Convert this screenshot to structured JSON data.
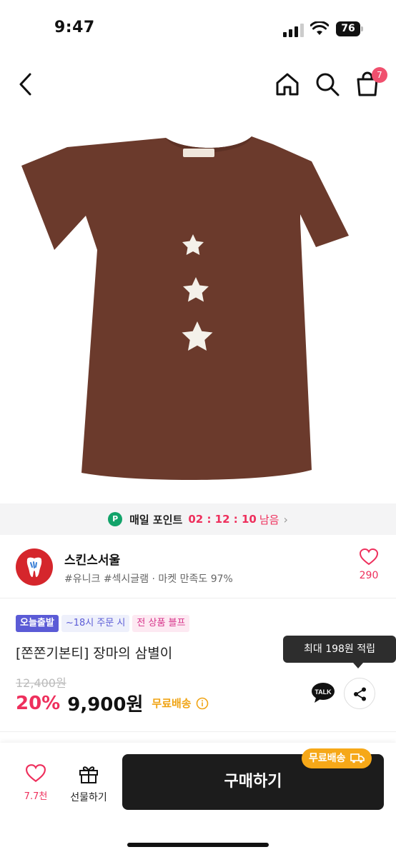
{
  "status_bar": {
    "time": "9:47",
    "battery": "76"
  },
  "nav": {
    "cart_count": "7"
  },
  "points": {
    "badge": "P",
    "label": "매일 포인트",
    "timer": "02 : 12 : 10",
    "remain": "남음",
    "chevron": "›"
  },
  "shop": {
    "name": "스킨스서울",
    "tags": "#유니크 #섹시글램 · 마켓 만족도 97%",
    "likes": "290"
  },
  "badges": {
    "today": "오늘출발",
    "order": "~18시 주문 시",
    "all": "전 상품 블프"
  },
  "product": {
    "title": "[쫀쫀기본티] 장마의 삼별이",
    "original_price": "12,400원",
    "discount": "20%",
    "price": "9,900원",
    "shipping": "무료배송",
    "tooltip": "최대 198원 적립",
    "talk": "TALK"
  },
  "bottom": {
    "likes": "7.7천",
    "gift": "선물하기",
    "buy": "구매하기",
    "free_ship": "무료배송"
  },
  "colors": {
    "accent": "#ee2f5c",
    "shirt": "#6b3a2c",
    "shipping": "#f0a414",
    "points_green": "#12a36a",
    "buy_bg": "#1c1c1c"
  },
  "icons": [
    "back-icon",
    "home-icon",
    "search-icon",
    "cart-icon",
    "heart-icon",
    "info-icon",
    "talk-icon",
    "share-icon",
    "gift-icon",
    "truck-icon",
    "star-icon"
  ]
}
